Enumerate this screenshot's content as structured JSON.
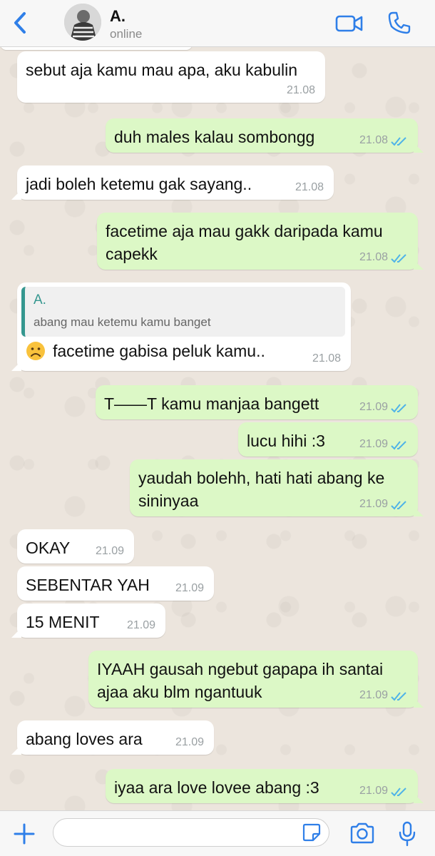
{
  "header": {
    "back_label": "back",
    "contact_name": "A.",
    "status": "online",
    "icons": [
      "chevron-left-icon",
      "video-camera-icon",
      "phone-icon"
    ],
    "accent_color": "#2f7fe8"
  },
  "messages": [
    {
      "direction": "in",
      "text": "sebut aja kamu mau apa, aku kabulin",
      "time": "21.08"
    },
    {
      "direction": "out",
      "text": "duh males kalau sombongg",
      "time": "21.08",
      "read": true
    },
    {
      "direction": "in",
      "text": "jadi boleh ketemu gak sayang..",
      "time": "21.08"
    },
    {
      "direction": "out",
      "lines": [
        "facetime aja mau gakk daripada kamu",
        "capekk"
      ],
      "time": "21.08",
      "read": true
    },
    {
      "direction": "in",
      "quote_author": "A.",
      "quote_text": "abang mau ketemu kamu banget",
      "text": "facetime gabisa peluk kamu..",
      "emoji": "frowning-face-icon",
      "time": "21.08"
    },
    {
      "direction": "out",
      "text": "T——T kamu manjaa bangett",
      "time": "21.09",
      "read": true
    },
    {
      "direction": "out",
      "text": "lucu hihi :3",
      "time": "21.09",
      "read": true
    },
    {
      "direction": "out",
      "lines": [
        "yaudah bolehh, hati hati abang ke",
        "sininyaa"
      ],
      "time": "21.09",
      "read": true
    },
    {
      "direction": "in",
      "text": "OKAY",
      "time": "21.09"
    },
    {
      "direction": "in",
      "text": "SEBENTAR YAH",
      "time": "21.09"
    },
    {
      "direction": "in",
      "text": "15 MENIT",
      "time": "21.09"
    },
    {
      "direction": "out",
      "lines": [
        "IYAAH gausah ngebut gapapa ih santai",
        "ajaa aku blm ngantuuk"
      ],
      "time": "21.09",
      "read": true
    },
    {
      "direction": "in",
      "text": "abang loves ara",
      "time": "21.09"
    },
    {
      "direction": "out",
      "text": "iyaa ara love lovee abang :3",
      "time": "21.09",
      "read": true
    }
  ],
  "input_bar": {
    "placeholder": "",
    "icons": [
      "plus-icon",
      "sticker-icon",
      "camera-icon",
      "microphone-icon"
    ]
  },
  "colors": {
    "incoming_bubble": "#ffffff",
    "outgoing_bubble": "#dcf8c6",
    "read_ticks": "#4fb3e8",
    "quote_accent": "#35978f"
  }
}
